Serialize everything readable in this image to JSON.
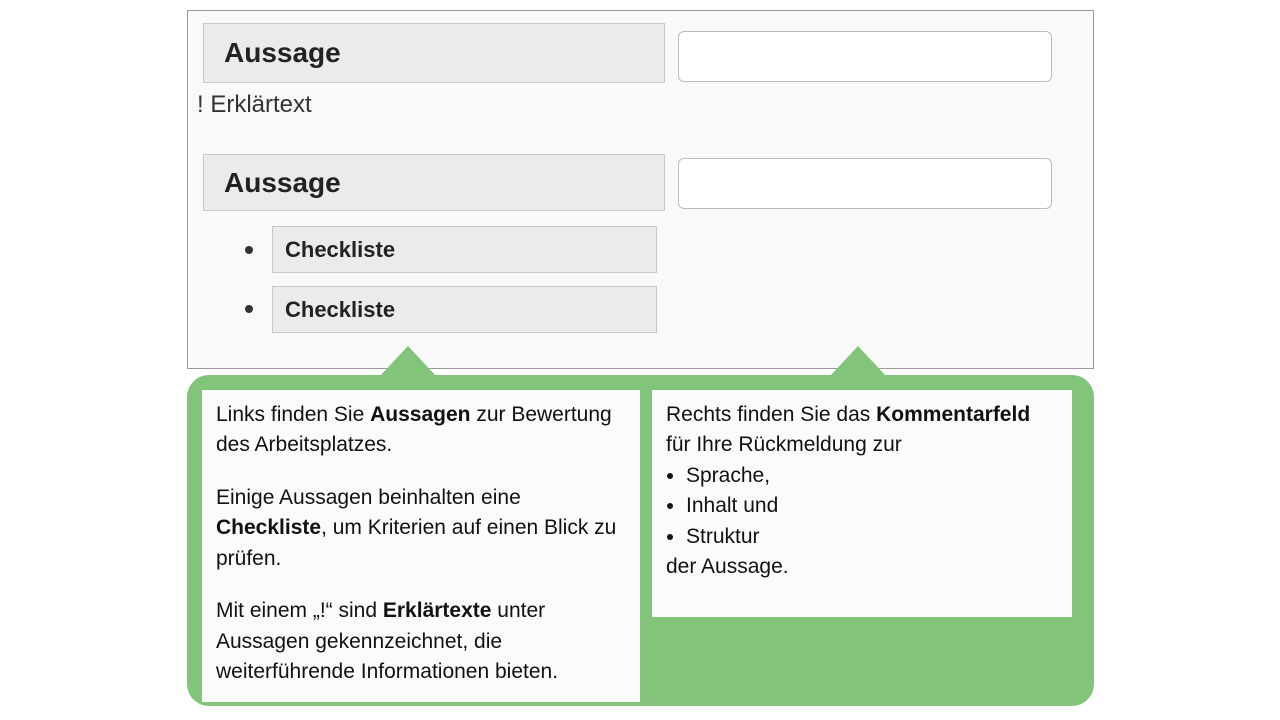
{
  "panel": {
    "aussage1": "Aussage",
    "erklaertext": "! Erklärtext",
    "aussage2": "Aussage",
    "checkliste1": "Checkliste",
    "checkliste2": "Checkliste"
  },
  "left": {
    "p1a": "Links finden Sie ",
    "p1b": "Aussagen",
    "p1c": " zur Bewertung des Arbeitsplatzes.",
    "p2a": "Einige Aussagen beinhalten eine ",
    "p2b": "Checkliste",
    "p2c": ", um Kriterien auf einen Blick zu prüfen.",
    "p3a": "Mit einem „!“ sind ",
    "p3b": "Erklärtexte",
    "p3c": " unter Aussagen gekennzeichnet, die weiterführende Informationen bieten."
  },
  "right": {
    "p1a": "Rechts finden Sie das ",
    "p1b": "Kommentarfeld",
    "p1c": " für Ihre Rückmeldung zur",
    "li1": "Sprache,",
    "li2": "Inhalt und",
    "li3": "Struktur",
    "end": "der Aussage."
  }
}
